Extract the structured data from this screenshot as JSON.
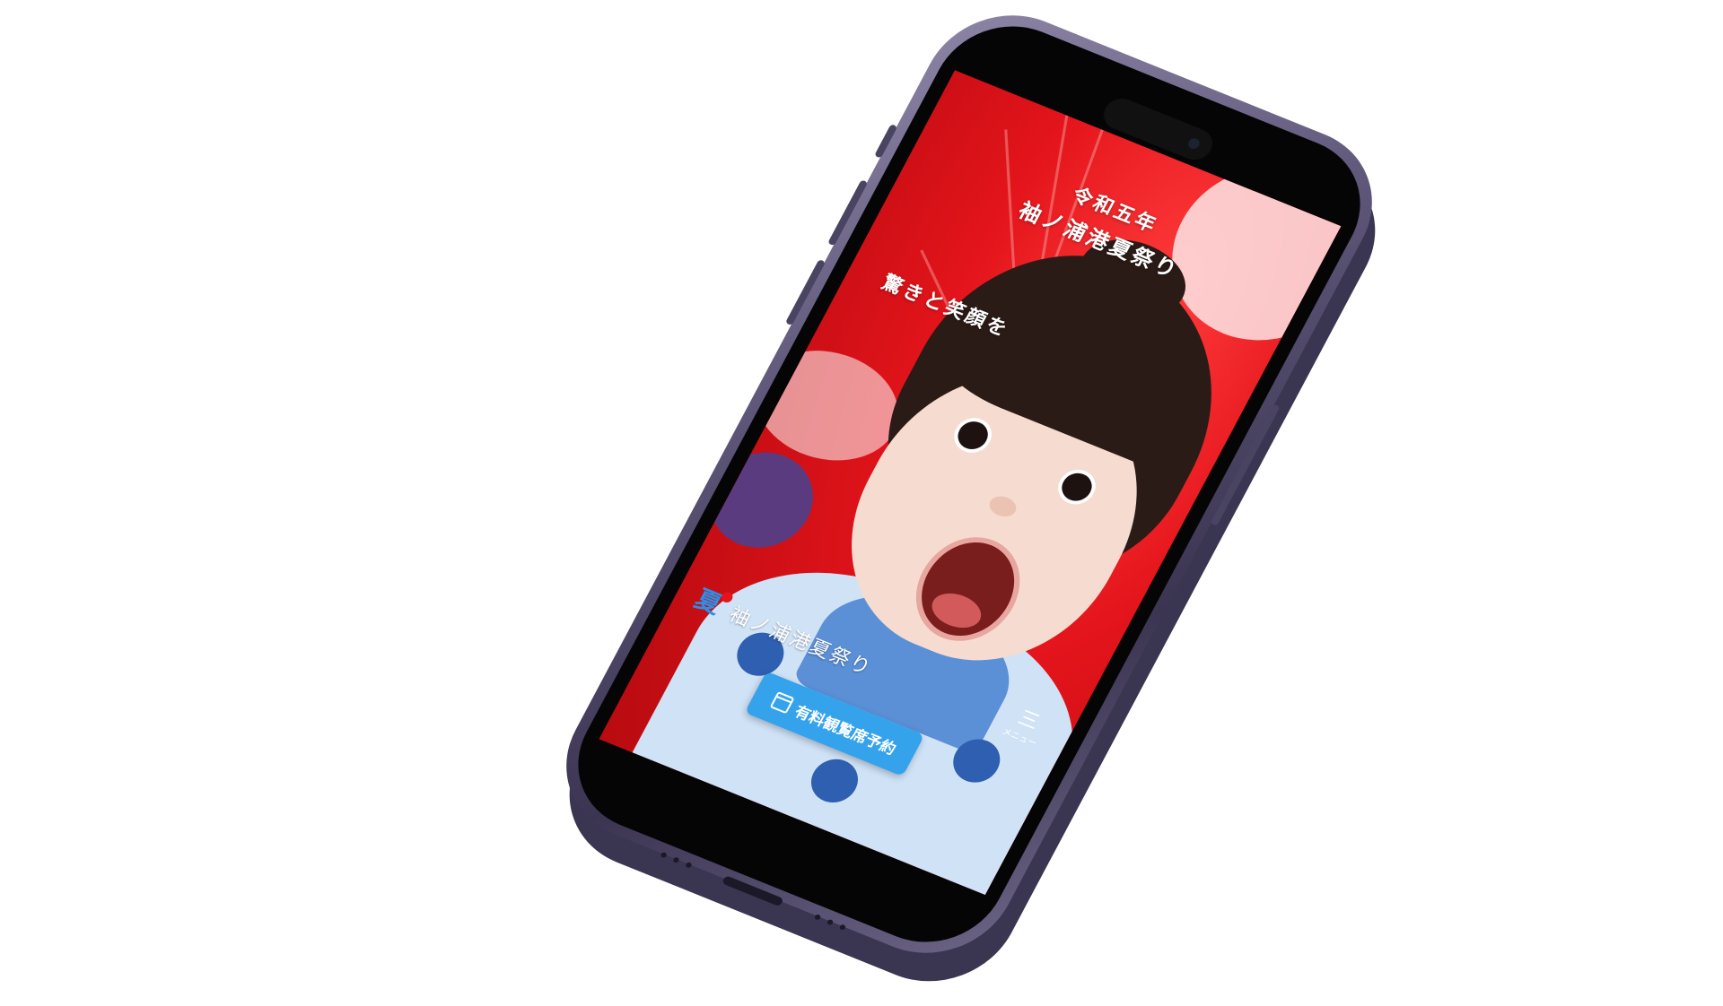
{
  "hero": {
    "era_title": "令和五年",
    "festival_title": "袖ノ浦港夏祭り",
    "catchphrase": "驚きと笑顔を"
  },
  "header": {
    "logo_char": "夏",
    "site_name": "袖ノ浦港夏祭り",
    "menu_icon": "三",
    "menu_label": "メニュー"
  },
  "cta": {
    "reserve_label": "有料観覧席予約",
    "icon": "calendar-icon"
  },
  "colors": {
    "accent_blue": "#35a3ec",
    "brand_red": "#e3141b",
    "logo_blue": "#2e8fe6",
    "phone_frame": "#5d5678"
  }
}
